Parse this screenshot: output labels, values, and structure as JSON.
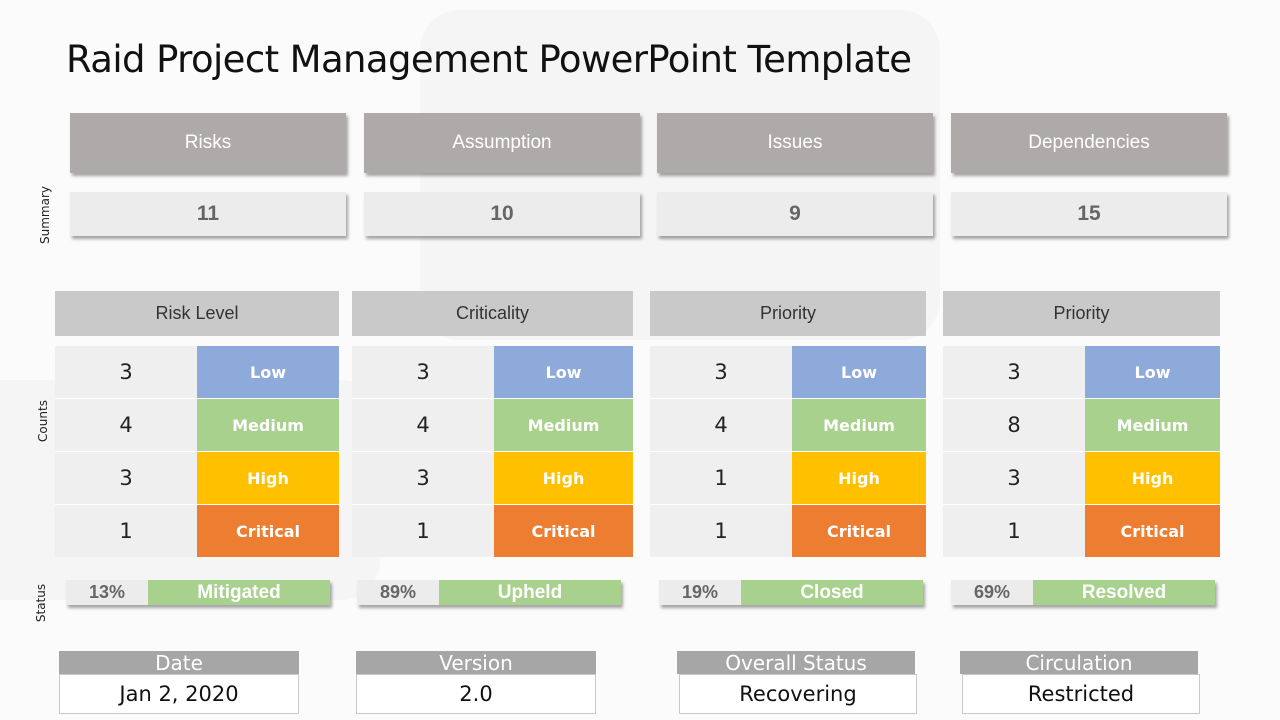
{
  "title": "Raid Project Management PowerPoint Template",
  "side_labels": {
    "summary": "Summary",
    "counts": "Counts",
    "status": "Status"
  },
  "summary": [
    {
      "label": "Risks",
      "value": "11"
    },
    {
      "label": "Assumption",
      "value": "10"
    },
    {
      "label": "Issues",
      "value": "9"
    },
    {
      "label": "Dependencies",
      "value": "15"
    }
  ],
  "level_colors": {
    "Low": "#8eaadb",
    "Medium": "#a9d18e",
    "High": "#ffc000",
    "Critical": "#ed7d31"
  },
  "blocks": [
    {
      "header": "Risk Level",
      "rows": [
        {
          "count": "3",
          "level": "Low"
        },
        {
          "count": "4",
          "level": "Medium"
        },
        {
          "count": "3",
          "level": "High"
        },
        {
          "count": "1",
          "level": "Critical"
        }
      ]
    },
    {
      "header": "Criticality",
      "rows": [
        {
          "count": "3",
          "level": "Low"
        },
        {
          "count": "4",
          "level": "Medium"
        },
        {
          "count": "3",
          "level": "High"
        },
        {
          "count": "1",
          "level": "Critical"
        }
      ]
    },
    {
      "header": "Priority",
      "rows": [
        {
          "count": "3",
          "level": "Low"
        },
        {
          "count": "4",
          "level": "Medium"
        },
        {
          "count": "1",
          "level": "High"
        },
        {
          "count": "1",
          "level": "Critical"
        }
      ]
    },
    {
      "header": "Priority",
      "rows": [
        {
          "count": "3",
          "level": "Low"
        },
        {
          "count": "8",
          "level": "Medium"
        },
        {
          "count": "3",
          "level": "High"
        },
        {
          "count": "1",
          "level": "Critical"
        }
      ]
    }
  ],
  "status": [
    {
      "percent": "13%",
      "label": "Mitigated"
    },
    {
      "percent": "89%",
      "label": "Upheld"
    },
    {
      "percent": "19%",
      "label": "Closed"
    },
    {
      "percent": "69%",
      "label": "Resolved"
    }
  ],
  "meta": [
    {
      "label": "Date",
      "value": "Jan 2, 2020"
    },
    {
      "label": "Version",
      "value": "2.0"
    },
    {
      "label": "Overall Status",
      "value": "Recovering"
    },
    {
      "label": "Circulation",
      "value": "Restricted"
    }
  ]
}
